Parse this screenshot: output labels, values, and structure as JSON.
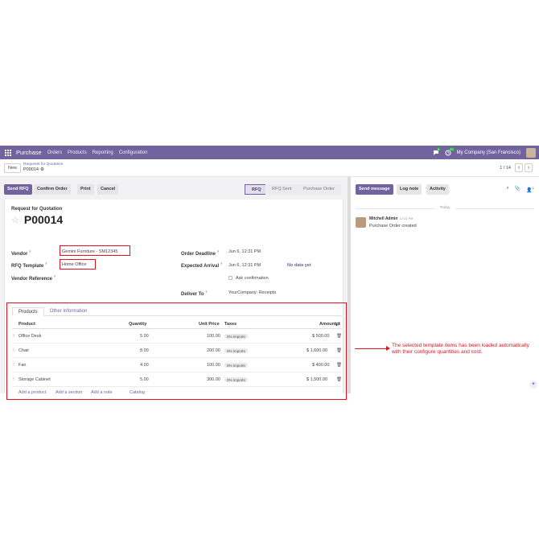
{
  "navbar": {
    "app_name": "Purchase",
    "menu": [
      "Orders",
      "Products",
      "Reporting",
      "Configuration"
    ],
    "chat_badge": "6",
    "activity_badge": "29",
    "company": "My Company (San Francisco)"
  },
  "control": {
    "new_label": "New",
    "breadcrumb_parent": "Requests for Quotation",
    "breadcrumb_current": "P00014",
    "pager": "1 / 14"
  },
  "statusbar": {
    "send_rfq": "Send RFQ",
    "confirm_order": "Confirm Order",
    "print": "Print",
    "cancel": "Cancel",
    "stages": [
      "RFQ",
      "RFQ Sent",
      "Purchase Order"
    ],
    "active_stage": "RFQ"
  },
  "form": {
    "doc_label": "Request for Quotation",
    "doc_title": "P00014",
    "vendor_label": "Vendor",
    "vendor_value": "Gemini Furniture - SM12345",
    "template_label": "RFQ Template",
    "template_value": "Home Office",
    "vendor_ref_label": "Vendor Reference",
    "order_deadline_label": "Order Deadline",
    "order_deadline_value": "Jun 6, 12:31 PM",
    "expected_arrival_label": "Expected Arrival",
    "expected_arrival_value": "Jun 6, 12:31 PM",
    "no_data": "No data yet",
    "ask_confirmation": "Ask confirmation",
    "deliver_to_label": "Deliver To",
    "deliver_to_value": "YourCompany: Receipts",
    "help_mark": "?"
  },
  "products": {
    "tabs": [
      "Products",
      "Other Information"
    ],
    "headers": {
      "product": "Product",
      "quantity": "Quantity",
      "unit_price": "Unit Price",
      "taxes": "Taxes",
      "amount": "Amount"
    },
    "rows": [
      {
        "product": "Office Desk",
        "quantity": "5.00",
        "unit_price": "100.00",
        "tax": "0% Imports",
        "amount": "$ 500.00"
      },
      {
        "product": "Chair",
        "quantity": "8.00",
        "unit_price": "200.00",
        "tax": "0% Imports",
        "amount": "$ 1,600.00"
      },
      {
        "product": "Fan",
        "quantity": "4.00",
        "unit_price": "100.00",
        "tax": "0% Imports",
        "amount": "$ 400.00"
      },
      {
        "product": "Storage Cabinet",
        "quantity": "5.00",
        "unit_price": "300.00",
        "tax": "0% Imports",
        "amount": "$ 1,500.00"
      }
    ],
    "links": {
      "add_product": "Add a product",
      "add_section": "Add a section",
      "add_note": "Add a note",
      "catalog": "Catalog"
    }
  },
  "chatter": {
    "send_message": "Send message",
    "log_note": "Log note",
    "activity": "Activity",
    "followers_count": "1",
    "today": "Today",
    "author": "Mitchell Admin",
    "time": "12:31 PM",
    "body": "Purchase Order created"
  },
  "annotation": "The selected template items has been loaded automatically with their configure quantities and cost.",
  "colors": {
    "brand": "#71639e",
    "highlight": "#e0141e"
  }
}
